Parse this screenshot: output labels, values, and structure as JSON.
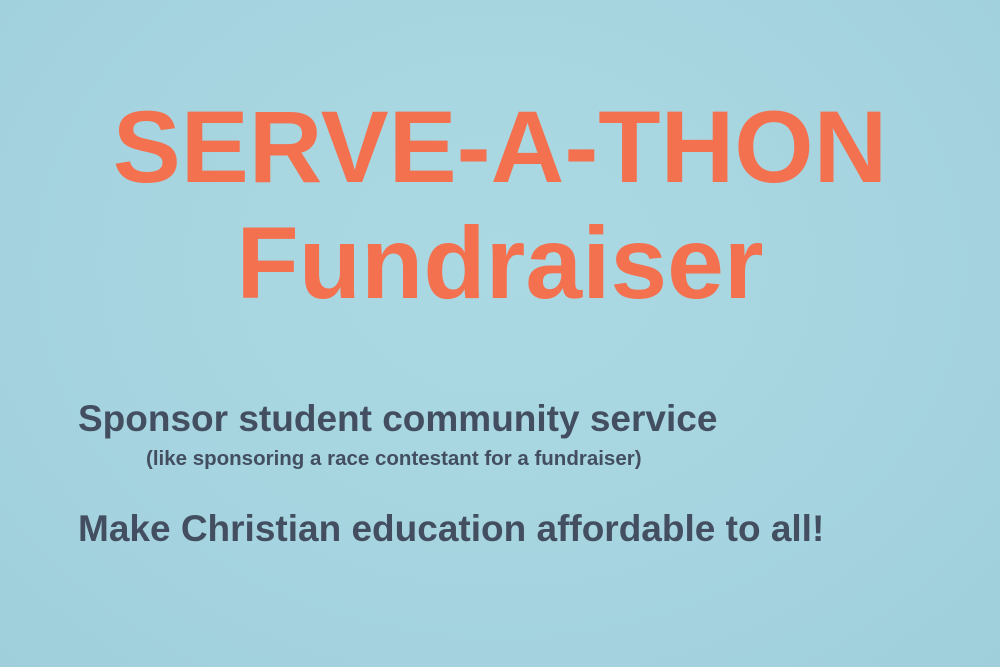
{
  "slide": {
    "title_line1": "SERVE-A-THON",
    "title_line2": "Fundraiser",
    "point1": "Sponsor student community service",
    "point1_note": "(like sponsoring a race contestant for a fundraiser)",
    "point2": "Make Christian education affordable to all!"
  },
  "colors": {
    "background": "#a7d6e1",
    "title": "#f47150",
    "body_text": "#434f61"
  }
}
